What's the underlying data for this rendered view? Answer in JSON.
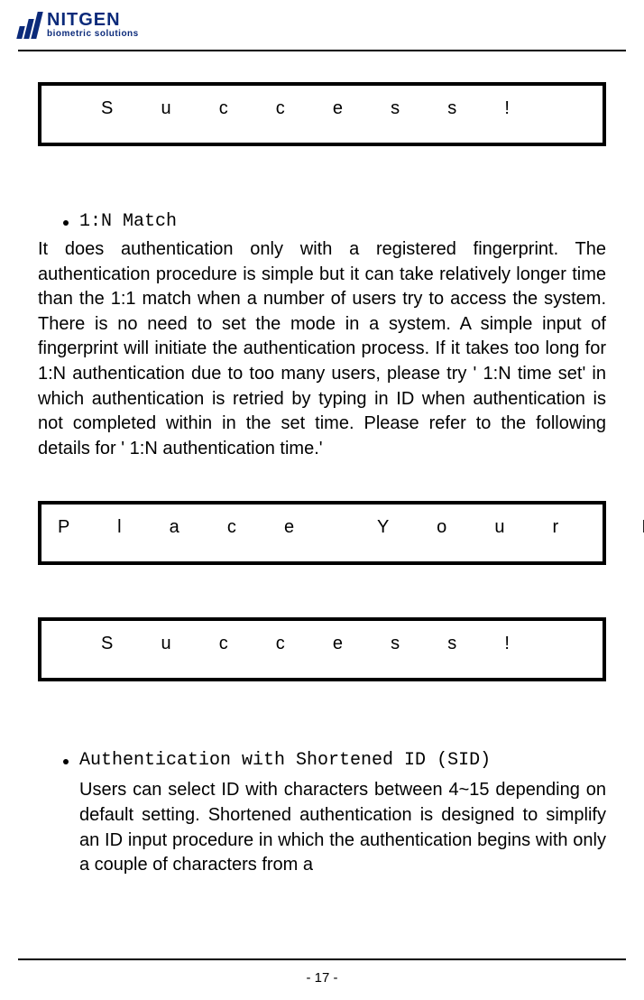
{
  "brand": {
    "name": "NITGEN",
    "tagline": "biometric solutions"
  },
  "display1": "S  u  c  c  e  s  s  !",
  "section1": {
    "title": "1:N Match",
    "body": "It does authentication only with a registered fingerprint. The authentication procedure is simple but it can take relatively longer time than the 1:1 match when a number of users try to access the system. There is no need to set the mode in a system. A simple input of fingerprint will initiate the authentication process. If it takes too long for 1:N authentication due to too many users, please try ' 1:N time set'  in which authentication is retried by typing in ID when authentication is not completed within in the set time. Please refer to the following details for ' 1:N authentication time.'"
  },
  "display2": "P  l  a  c  e    Y  o  u  r    F  P",
  "display3": "S  u  c  c  e  s  s  !",
  "section2": {
    "title": "Authentication with Shortened ID (SID)",
    "body": "Users can select ID with characters between 4~15 depending on default setting. Shortened authentication is designed to simplify an ID input procedure in which the authentication begins with only a couple of characters from a"
  },
  "page_number": "- 17 -"
}
